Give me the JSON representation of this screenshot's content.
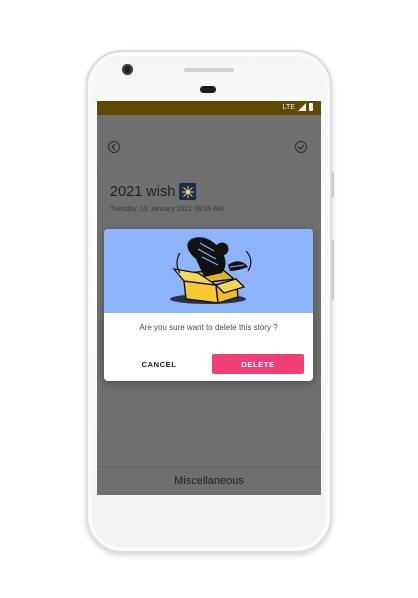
{
  "status_bar": {
    "network": "LTE"
  },
  "story": {
    "title": "2021 wish",
    "title_emoji": "sparkler-emoji",
    "date": "Tuesday, 19 January 2021 09:39 AM"
  },
  "footer": {
    "category": "Miscellaneous"
  },
  "dialog": {
    "message": "Are you sure want to delete this story ?",
    "cancel_label": "CANCEL",
    "delete_label": "DELETE",
    "illustration": "person-digging-box-illustration"
  },
  "colors": {
    "status_bar": "#5e4a00",
    "scrim_background": "#6f6f6f",
    "dialog_art_background": "#8db3fa",
    "delete_button": "#f03f76",
    "box_yellow": "#f7c833"
  },
  "icons": {
    "back": "back-arrow-circle-icon",
    "save": "check-circle-icon",
    "signal": "signal-icon",
    "battery": "battery-icon"
  }
}
